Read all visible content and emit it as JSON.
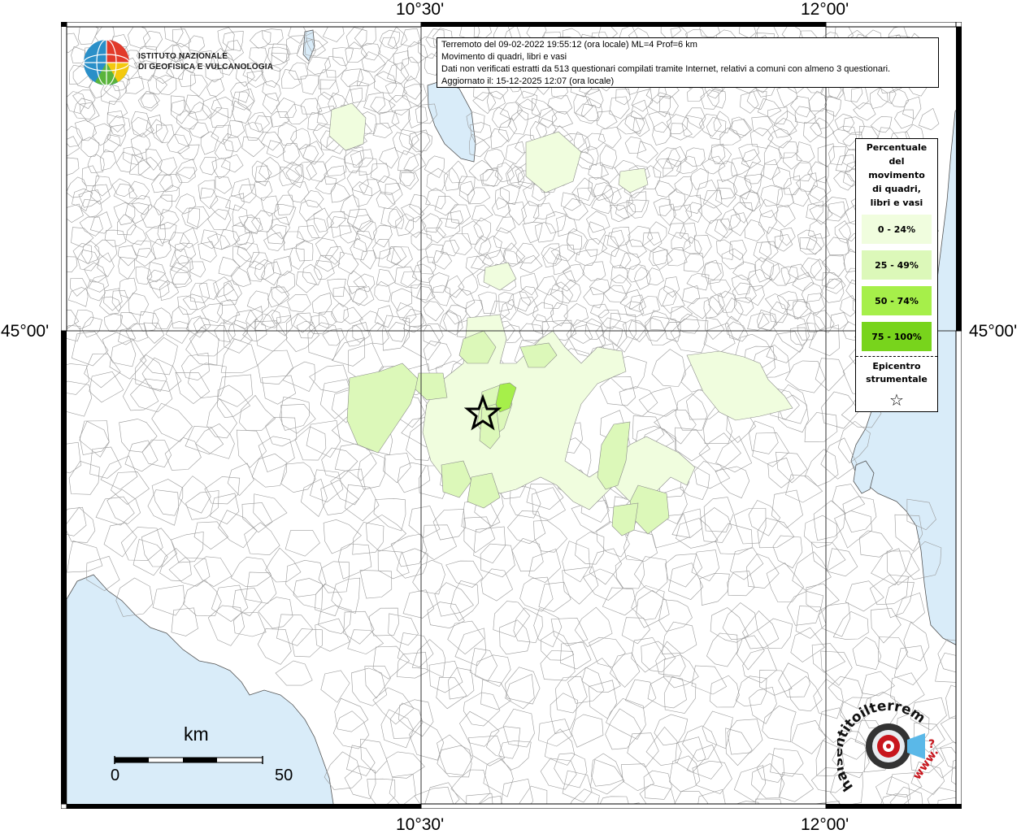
{
  "map": {
    "coord_labels": {
      "lon_left_top": "10°30'",
      "lon_right_top": "12°00'",
      "lon_left_bottom": "10°30'",
      "lon_right_bottom": "12°00'",
      "lat_left": "45°00'",
      "lat_right": "45°00'"
    },
    "colors": {
      "sea": "#d9ecf9",
      "land": "#ffffff",
      "border": "#9a9a9a",
      "grid": "#333333",
      "class_0_24": "#f0fdde",
      "class_25_49": "#dcf8b9",
      "class_50_74": "#a6ef4a",
      "class_75_100": "#78d41c"
    }
  },
  "info": {
    "line1": "Terremoto del 09-02-2022 19:55:12 (ora locale) ML=4 Prof=6 km",
    "line2": "Movimento di quadri, libri e vasi",
    "line3": "Dati non verificati estratti da 513 questionari compilati tramite Internet, relativi a comuni con almeno 3 questionari.",
    "line4": "Aggiornato il: 15-12-2025 12:07 (ora locale)"
  },
  "legend": {
    "title_lines": [
      "Percentuale",
      "del",
      "movimento",
      "di quadri,",
      "libri e vasi"
    ],
    "classes": [
      {
        "label": "0 - 24%",
        "color": "#f0fdde"
      },
      {
        "label": "25 - 49%",
        "color": "#dcf8b9"
      },
      {
        "label": "50 - 74%",
        "color": "#a6ef4a"
      },
      {
        "label": "75 - 100%",
        "color": "#78d41c"
      }
    ],
    "epicenter_lines": [
      "Epicentro",
      "strumentale"
    ],
    "epicenter_symbol": "☆"
  },
  "logos": {
    "ingv_line1": "ISTITUTO NAZIONALE",
    "ingv_line2": "DI GEOFISICA E VULCANOLOGIA",
    "hsit_text": "haisentitoilterremoto.it",
    "hsit_www": "www.",
    "hsit_question": "?"
  },
  "scale": {
    "unit": "km",
    "start": "0",
    "end": "50"
  }
}
